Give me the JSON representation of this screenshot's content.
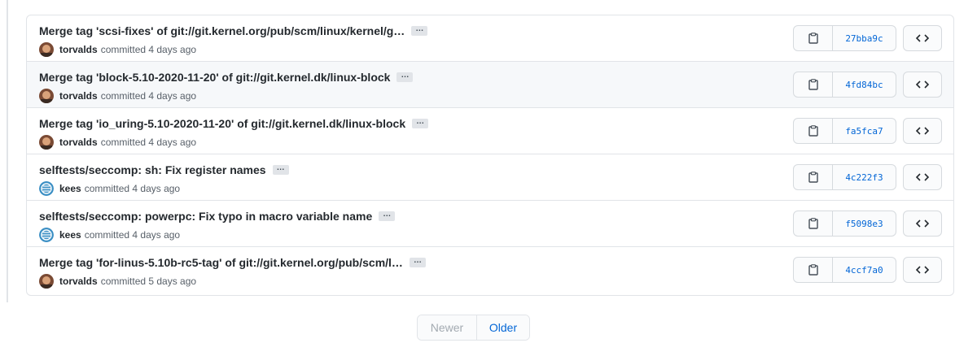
{
  "commits": [
    {
      "message": "Merge tag 'scsi-fixes' of git://git.kernel.org/pub/scm/linux/kernel/g…",
      "author": "torvalds",
      "when": "committed 4 days ago",
      "sha": "27bba9c",
      "avatar": "torvalds"
    },
    {
      "message": "Merge tag 'block-5.10-2020-11-20' of git://git.kernel.dk/linux-block",
      "author": "torvalds",
      "when": "committed 4 days ago",
      "sha": "4fd84bc",
      "avatar": "torvalds"
    },
    {
      "message": "Merge tag 'io_uring-5.10-2020-11-20' of git://git.kernel.dk/linux-block",
      "author": "torvalds",
      "when": "committed 4 days ago",
      "sha": "fa5fca7",
      "avatar": "torvalds"
    },
    {
      "message": "selftests/seccomp: sh: Fix register names",
      "author": "kees",
      "when": "committed 4 days ago",
      "sha": "4c222f3",
      "avatar": "kees"
    },
    {
      "message": "selftests/seccomp: powerpc: Fix typo in macro variable name",
      "author": "kees",
      "when": "committed 4 days ago",
      "sha": "f5098e3",
      "avatar": "kees"
    },
    {
      "message": "Merge tag 'for-linus-5.10b-rc5-tag' of git://git.kernel.org/pub/scm/l…",
      "author": "torvalds",
      "when": "committed 5 days ago",
      "sha": "4ccf7a0",
      "avatar": "torvalds"
    }
  ],
  "ellipsis_label": "…",
  "pagination": {
    "newer": "Newer",
    "older": "Older"
  }
}
